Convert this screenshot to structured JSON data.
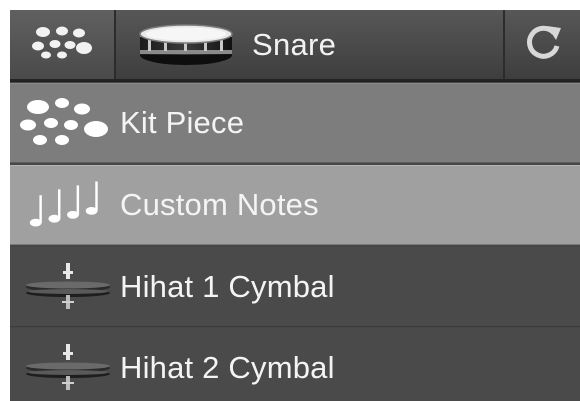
{
  "toolbar": {
    "kit_icon": "drum-kit-icon",
    "instrument_icon": "snare-drum-icon",
    "title": "Snare",
    "reset_icon": "refresh-icon"
  },
  "menu": {
    "items": [
      {
        "label": "Kit Piece",
        "icon": "drum-kit-icon",
        "selected": false
      },
      {
        "label": "Custom Notes",
        "icon": "music-notes-icon",
        "selected": true
      },
      {
        "label": "Hihat 1 Cymbal",
        "icon": "hihat-cymbal-icon",
        "selected": false
      },
      {
        "label": "Hihat 2 Cymbal",
        "icon": "hihat-cymbal-icon",
        "selected": false
      }
    ]
  },
  "colors": {
    "panel_bg": "#474747",
    "kit_piece_row": "#7d7d7d",
    "selected_row": "#a0a0a0",
    "cymbal_row": "#4a4a4a",
    "text": "#f4f4f4"
  }
}
